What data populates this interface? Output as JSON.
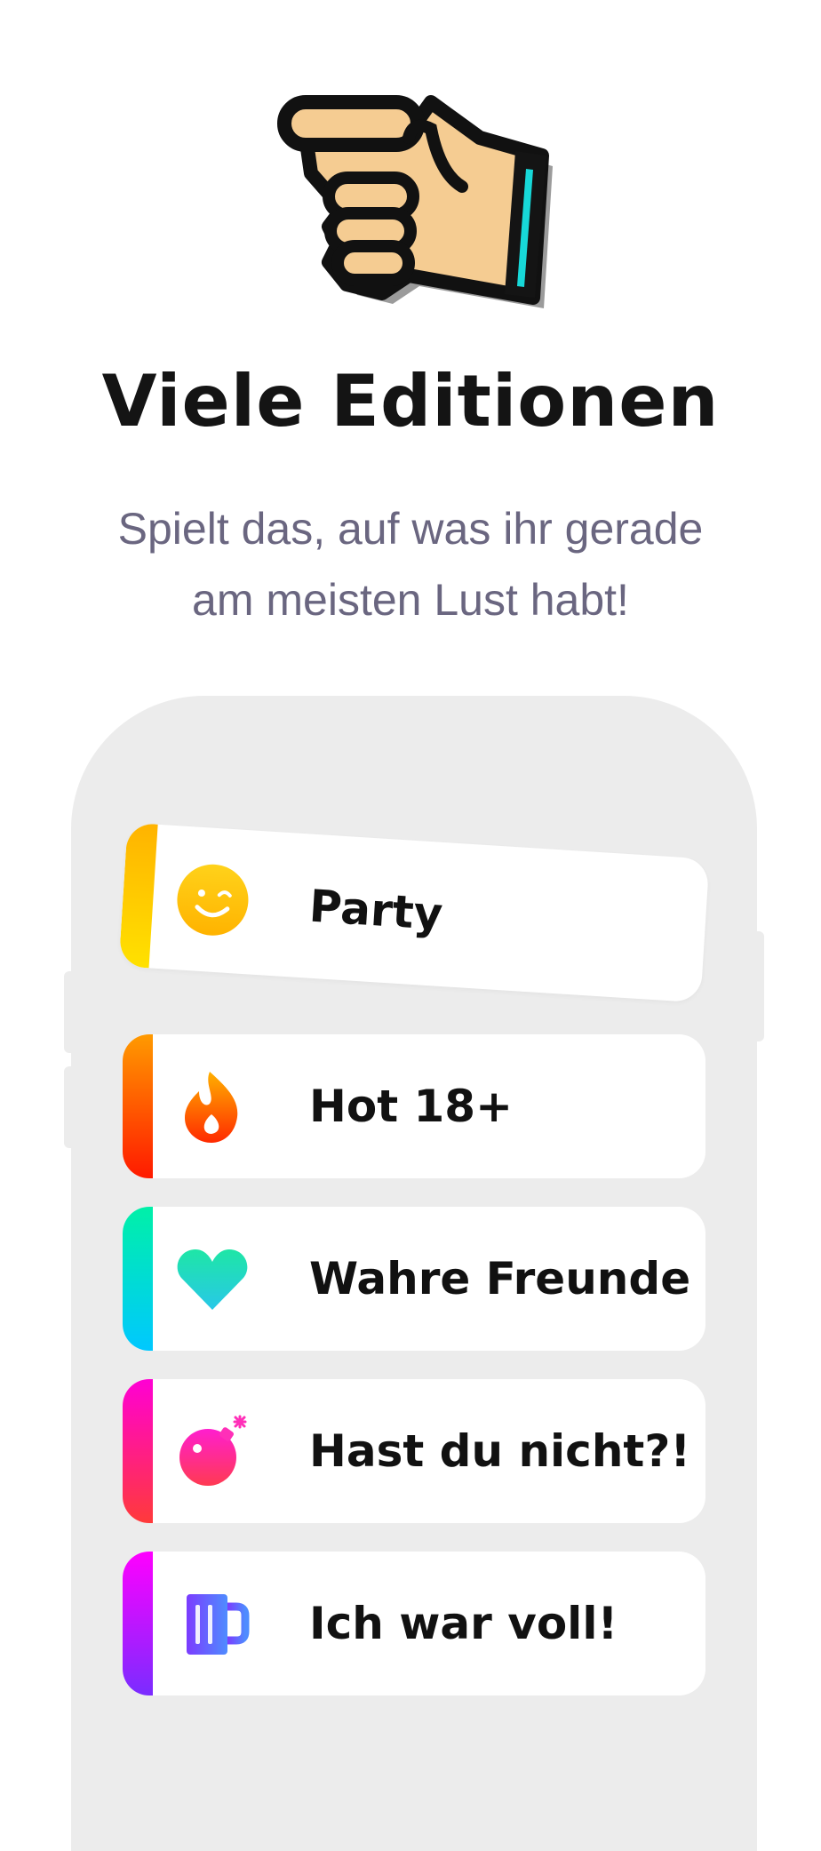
{
  "hero": {
    "icon": "pointing-hand-icon",
    "title": "Viele Editionen",
    "subtitle_line1": "Spielt das, auf was ihr gerade",
    "subtitle_line2": "am meisten Lust habt!"
  },
  "editions": [
    {
      "label": "Party",
      "icon": "winking-smiley-icon",
      "accent": [
        "#ffe100",
        "#ffb300"
      ]
    },
    {
      "label": "Hot 18+",
      "icon": "flame-icon",
      "accent": [
        "#ff9a00",
        "#ff1a00"
      ]
    },
    {
      "label": "Wahre Freunde",
      "icon": "heart-icon",
      "accent": [
        "#00f0a8",
        "#00c8ff"
      ]
    },
    {
      "label": "Hast du nicht?!",
      "icon": "bomb-icon",
      "accent": [
        "#ff00d4",
        "#ff3a3a"
      ]
    },
    {
      "label": "Ich war voll!",
      "icon": "beer-mug-icon",
      "accent": [
        "#ff00ff",
        "#7a2cff"
      ]
    }
  ]
}
